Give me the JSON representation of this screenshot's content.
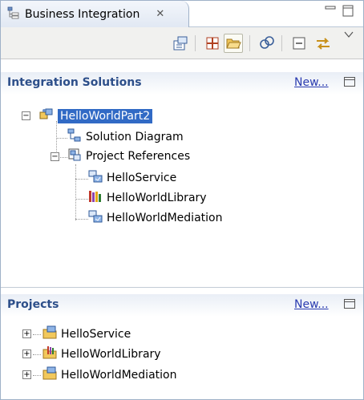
{
  "view": {
    "tab_title": "Business Integration",
    "tab_close_symbol": "✕",
    "minimize_symbol": "▭",
    "maximize_symbol": "☐"
  },
  "toolbar": {
    "buttons": [
      {
        "name": "solution-wizard-icon"
      },
      {
        "name": "show-grid-icon"
      },
      {
        "name": "open-folder-icon"
      },
      {
        "name": "link-icon"
      },
      {
        "name": "collapse-all-icon"
      },
      {
        "name": "sync-arrows-icon"
      },
      {
        "name": "view-menu-icon"
      }
    ]
  },
  "integration_solutions": {
    "title": "Integration Solutions",
    "new_label": "New...",
    "tree": {
      "root": "HelloWorldPart2",
      "solution_diagram": "Solution Diagram",
      "project_references": "Project References",
      "references": [
        "HelloService",
        "HelloWorldLibrary",
        "HelloWorldMediation"
      ]
    }
  },
  "projects": {
    "title": "Projects",
    "new_label": "New...",
    "items": [
      "HelloService",
      "HelloWorldLibrary",
      "HelloWorldMediation"
    ]
  },
  "colors": {
    "selection": "#316ac5",
    "section_title": "#2d4f8a",
    "link": "#2a3bb0"
  }
}
